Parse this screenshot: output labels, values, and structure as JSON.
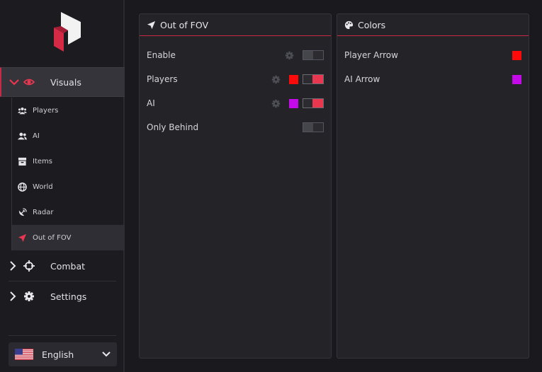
{
  "sidebar": {
    "visuals_label": "Visuals",
    "sub_items": [
      {
        "label": "Players",
        "icon": "users-icon"
      },
      {
        "label": "AI",
        "icon": "user-group-icon"
      },
      {
        "label": "Items",
        "icon": "box-icon"
      },
      {
        "label": "World",
        "icon": "globe-icon"
      },
      {
        "label": "Radar",
        "icon": "satellite-dish-icon"
      },
      {
        "label": "Out of FOV",
        "icon": "location-arrow-icon"
      }
    ],
    "combat_label": "Combat",
    "settings_label": "Settings",
    "language": "English"
  },
  "fov_panel": {
    "title": "Out of FOV",
    "rows": [
      {
        "label": "Enable",
        "enabled": false
      },
      {
        "label": "Players",
        "enabled": true,
        "color": "#ff0a0a"
      },
      {
        "label": "AI",
        "enabled": true,
        "color": "#c40ae8"
      },
      {
        "label": "Only Behind",
        "enabled": false
      }
    ]
  },
  "colors_panel": {
    "title": "Colors",
    "rows": [
      {
        "label": "Player Arrow",
        "color": "#ff0a0a"
      },
      {
        "label": "AI Arrow",
        "color": "#c40ae8"
      }
    ]
  },
  "theme": {
    "accent": "#c82a45",
    "toggle_on": "#e8374f"
  }
}
